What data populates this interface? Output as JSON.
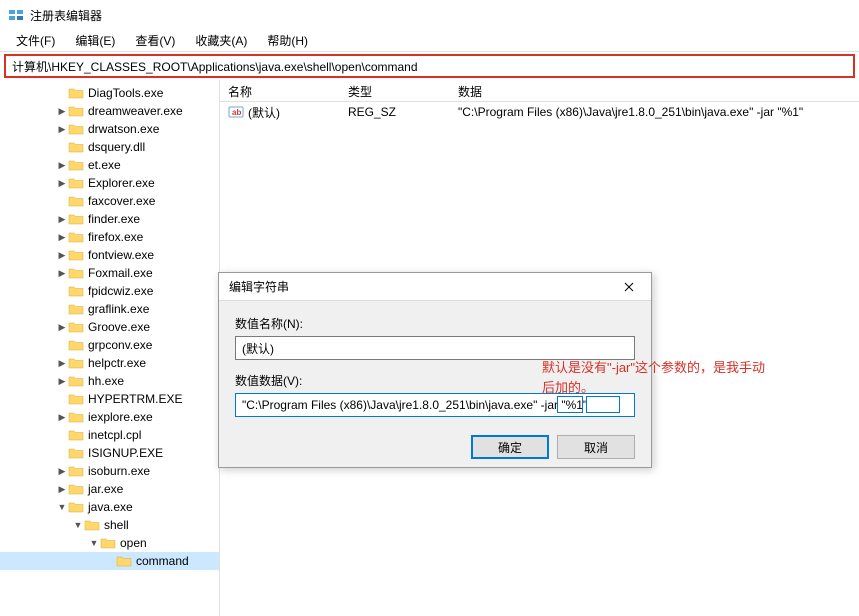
{
  "window": {
    "title": "注册表编辑器"
  },
  "menubar": {
    "file": "文件(F)",
    "edit": "编辑(E)",
    "view": "查看(V)",
    "favorites": "收藏夹(A)",
    "help": "帮助(H)"
  },
  "address": "计算机\\HKEY_CLASSES_ROOT\\Applications\\java.exe\\shell\\open\\command",
  "columns": {
    "name": "名称",
    "type": "类型",
    "data": "数据"
  },
  "row": {
    "name": "(默认)",
    "type": "REG_SZ",
    "data": "\"C:\\Program Files (x86)\\Java\\jre1.8.0_251\\bin\\java.exe\" -jar \"%1\""
  },
  "tree": {
    "items": [
      {
        "name": "DiagTools.exe",
        "depth": 3,
        "arrow": ""
      },
      {
        "name": "dreamweaver.exe",
        "depth": 3,
        "arrow": ">"
      },
      {
        "name": "drwatson.exe",
        "depth": 3,
        "arrow": ">"
      },
      {
        "name": "dsquery.dll",
        "depth": 3,
        "arrow": ""
      },
      {
        "name": "et.exe",
        "depth": 3,
        "arrow": ">"
      },
      {
        "name": "Explorer.exe",
        "depth": 3,
        "arrow": ">"
      },
      {
        "name": "faxcover.exe",
        "depth": 3,
        "arrow": ""
      },
      {
        "name": "finder.exe",
        "depth": 3,
        "arrow": ">"
      },
      {
        "name": "firefox.exe",
        "depth": 3,
        "arrow": ">"
      },
      {
        "name": "fontview.exe",
        "depth": 3,
        "arrow": ">"
      },
      {
        "name": "Foxmail.exe",
        "depth": 3,
        "arrow": ">"
      },
      {
        "name": "fpidcwiz.exe",
        "depth": 3,
        "arrow": ""
      },
      {
        "name": "graflink.exe",
        "depth": 3,
        "arrow": ""
      },
      {
        "name": "Groove.exe",
        "depth": 3,
        "arrow": ">"
      },
      {
        "name": "grpconv.exe",
        "depth": 3,
        "arrow": ""
      },
      {
        "name": "helpctr.exe",
        "depth": 3,
        "arrow": ">"
      },
      {
        "name": "hh.exe",
        "depth": 3,
        "arrow": ">"
      },
      {
        "name": "HYPERTRM.EXE",
        "depth": 3,
        "arrow": ""
      },
      {
        "name": "iexplore.exe",
        "depth": 3,
        "arrow": ">"
      },
      {
        "name": "inetcpl.cpl",
        "depth": 3,
        "arrow": ""
      },
      {
        "name": "ISIGNUP.EXE",
        "depth": 3,
        "arrow": ""
      },
      {
        "name": "isoburn.exe",
        "depth": 3,
        "arrow": ">"
      },
      {
        "name": "jar.exe",
        "depth": 3,
        "arrow": ">"
      },
      {
        "name": "java.exe",
        "depth": 3,
        "arrow": "v"
      },
      {
        "name": "shell",
        "depth": 4,
        "arrow": "v"
      },
      {
        "name": "open",
        "depth": 5,
        "arrow": "v"
      },
      {
        "name": "command",
        "depth": 6,
        "arrow": "",
        "selected": true
      }
    ]
  },
  "dialog": {
    "title": "编辑字符串",
    "name_label": "数值名称(N):",
    "name_value": "(默认)",
    "data_label": "数值数据(V):",
    "data_value": "\"C:\\Program Files (x86)\\Java\\jre1.8.0_251\\bin\\java.exe\" -jar \"%1\"",
    "ok": "确定",
    "cancel": "取消"
  },
  "annotation": {
    "line1": "默认是没有\"-jar\"这个参数的，是我手动",
    "line2": "后加的。"
  }
}
